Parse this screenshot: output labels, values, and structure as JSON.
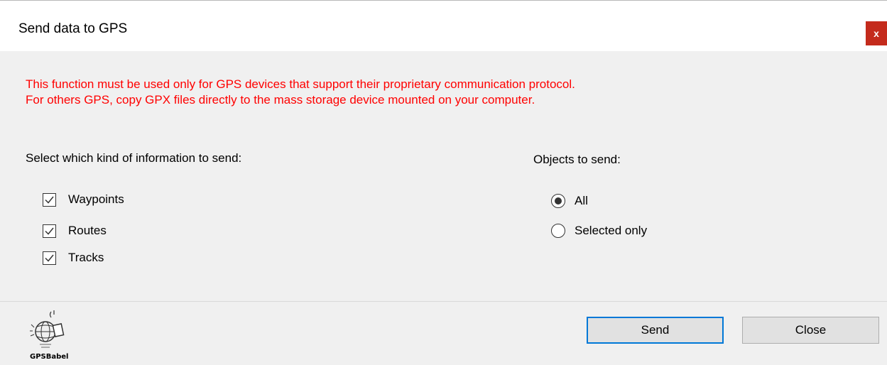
{
  "window": {
    "title": "Send data to GPS",
    "close_glyph": "x"
  },
  "warning": {
    "line1": "This function must be used only for GPS devices that support their proprietary communication protocol.",
    "line2": "For others GPS, copy GPX files directly to the mass storage device mounted on your computer."
  },
  "info_section": {
    "label": "Select which kind of information to send:",
    "options": [
      {
        "label": "Waypoints",
        "checked": true
      },
      {
        "label": "Routes",
        "checked": true
      },
      {
        "label": "Tracks",
        "checked": true
      }
    ]
  },
  "objects_section": {
    "label": "Objects to send:",
    "options": [
      {
        "label": "All",
        "selected": true
      },
      {
        "label": "Selected only",
        "selected": false
      }
    ]
  },
  "footer": {
    "logo_text": "GPSBabel",
    "send_label": "Send",
    "close_label": "Close"
  },
  "colors": {
    "warning": "#ff0000",
    "close_button": "#c42b1c",
    "primary_border": "#0078d7",
    "panel_background": "#f0f0f0"
  }
}
